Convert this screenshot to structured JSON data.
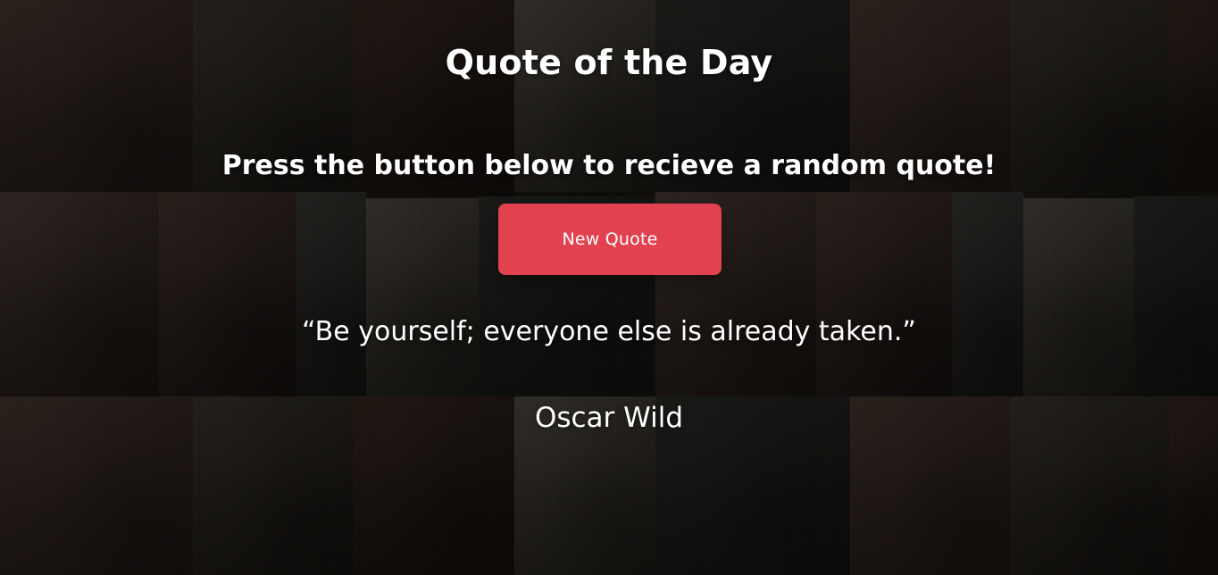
{
  "header": {
    "title": "Quote of the Day",
    "subtitle": "Press the button below to recieve a random quote!"
  },
  "actions": {
    "new_quote_label": "New Quote"
  },
  "quote": {
    "text": "“Be yourself; everyone else is already taken.”",
    "author": "Oscar Wild"
  },
  "theme": {
    "accent": "#e2414f",
    "text": "#ffffff",
    "overlay": "rgba(0,0,0,0.38)"
  }
}
